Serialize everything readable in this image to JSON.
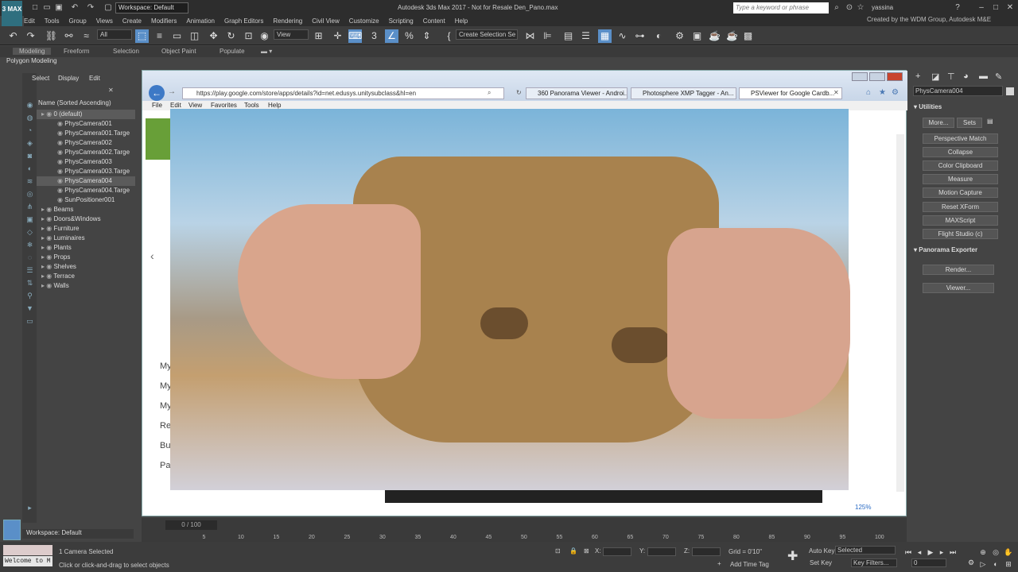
{
  "titlebar": {
    "logo": "3 MAX",
    "workspace": "Workspace: Default",
    "title": "Autodesk 3ds Max 2017  -  Not for Resale   Den_Pano.max",
    "search_placeholder": "Type a keyword or phrase",
    "user": "yassina"
  },
  "menubar": {
    "items": [
      "Edit",
      "Tools",
      "Group",
      "Views",
      "Create",
      "Modifiers",
      "Animation",
      "Graph Editors",
      "Rendering",
      "Civil View",
      "Customize",
      "Scripting",
      "Content",
      "Help"
    ],
    "credit": "Created by the WDM Group, Autodesk M&E"
  },
  "toolbar": {
    "filter": "All",
    "view": "View",
    "selection_set": "Create Selection Se"
  },
  "ribbon": {
    "tabs": [
      "Modeling",
      "Freeform",
      "Selection",
      "Object Paint",
      "Populate"
    ],
    "sub": "Polygon Modeling"
  },
  "explorer": {
    "tabs": [
      "Select",
      "Display",
      "Edit"
    ],
    "header": "Name (Sorted Ascending)",
    "items": [
      {
        "label": "0 (default)",
        "sel": true
      },
      {
        "label": "PhysCamera001"
      },
      {
        "label": "PhysCamera001.Targe"
      },
      {
        "label": "PhysCamera002"
      },
      {
        "label": "PhysCamera002.Targe"
      },
      {
        "label": "PhysCamera003"
      },
      {
        "label": "PhysCamera003.Targe"
      },
      {
        "label": "PhysCamera004",
        "sel": true
      },
      {
        "label": "PhysCamera004.Targe"
      },
      {
        "label": "SunPositioner001"
      },
      {
        "label": "Beams"
      },
      {
        "label": "Doors&Windows"
      },
      {
        "label": "Furniture"
      },
      {
        "label": "Luminaires"
      },
      {
        "label": "Plants"
      },
      {
        "label": "Props"
      },
      {
        "label": "Shelves"
      },
      {
        "label": "Terrace"
      },
      {
        "label": "Walls"
      }
    ]
  },
  "browser": {
    "url": "https://play.google.com/store/apps/details?id=net.edusys.unitysubclass&hl=en",
    "tabs": [
      "360 Panorama Viewer - Androi...",
      "Photosphere XMP Tagger - An...",
      "PSViewer for Google Cardb..."
    ],
    "menu": [
      "File",
      "Edit",
      "View",
      "Favorites",
      "Tools",
      "Help"
    ],
    "side": [
      "My",
      "My",
      "My",
      "Re",
      "Bu",
      "Pa"
    ],
    "zoom": "125%"
  },
  "cmdpanel": {
    "object_name": "PhysCamera004",
    "utilities": "Utilities",
    "more": "More...",
    "sets": "Sets",
    "buttons": [
      "Perspective Match",
      "Collapse",
      "Color Clipboard",
      "Measure",
      "Motion Capture",
      "Reset XForm",
      "MAXScript",
      "Flight Studio (c)"
    ],
    "exporter": "Panorama Exporter",
    "exporter_buttons": [
      "Render...",
      "Viewer..."
    ]
  },
  "timeline": {
    "frame": "0 / 100",
    "ticks": [
      "5",
      "10",
      "15",
      "20",
      "25",
      "30",
      "35",
      "40",
      "45",
      "50",
      "55",
      "60",
      "65",
      "70",
      "75",
      "80",
      "85",
      "90",
      "95",
      "100"
    ]
  },
  "status": {
    "workspace": "Workspace: Default",
    "welcome": "Welcome to M",
    "selected": "1 Camera Selected",
    "hint": "Click or click-and-drag to select objects",
    "x": "X:",
    "y": "Y:",
    "z": "Z:",
    "grid": "Grid = 0'10\"",
    "add_time_tag": "Add Time Tag",
    "auto_key": "Auto Key",
    "selected_drop": "Selected",
    "set_key": "Set Key",
    "key_filters": "Key Filters...",
    "frame_field": "0"
  }
}
